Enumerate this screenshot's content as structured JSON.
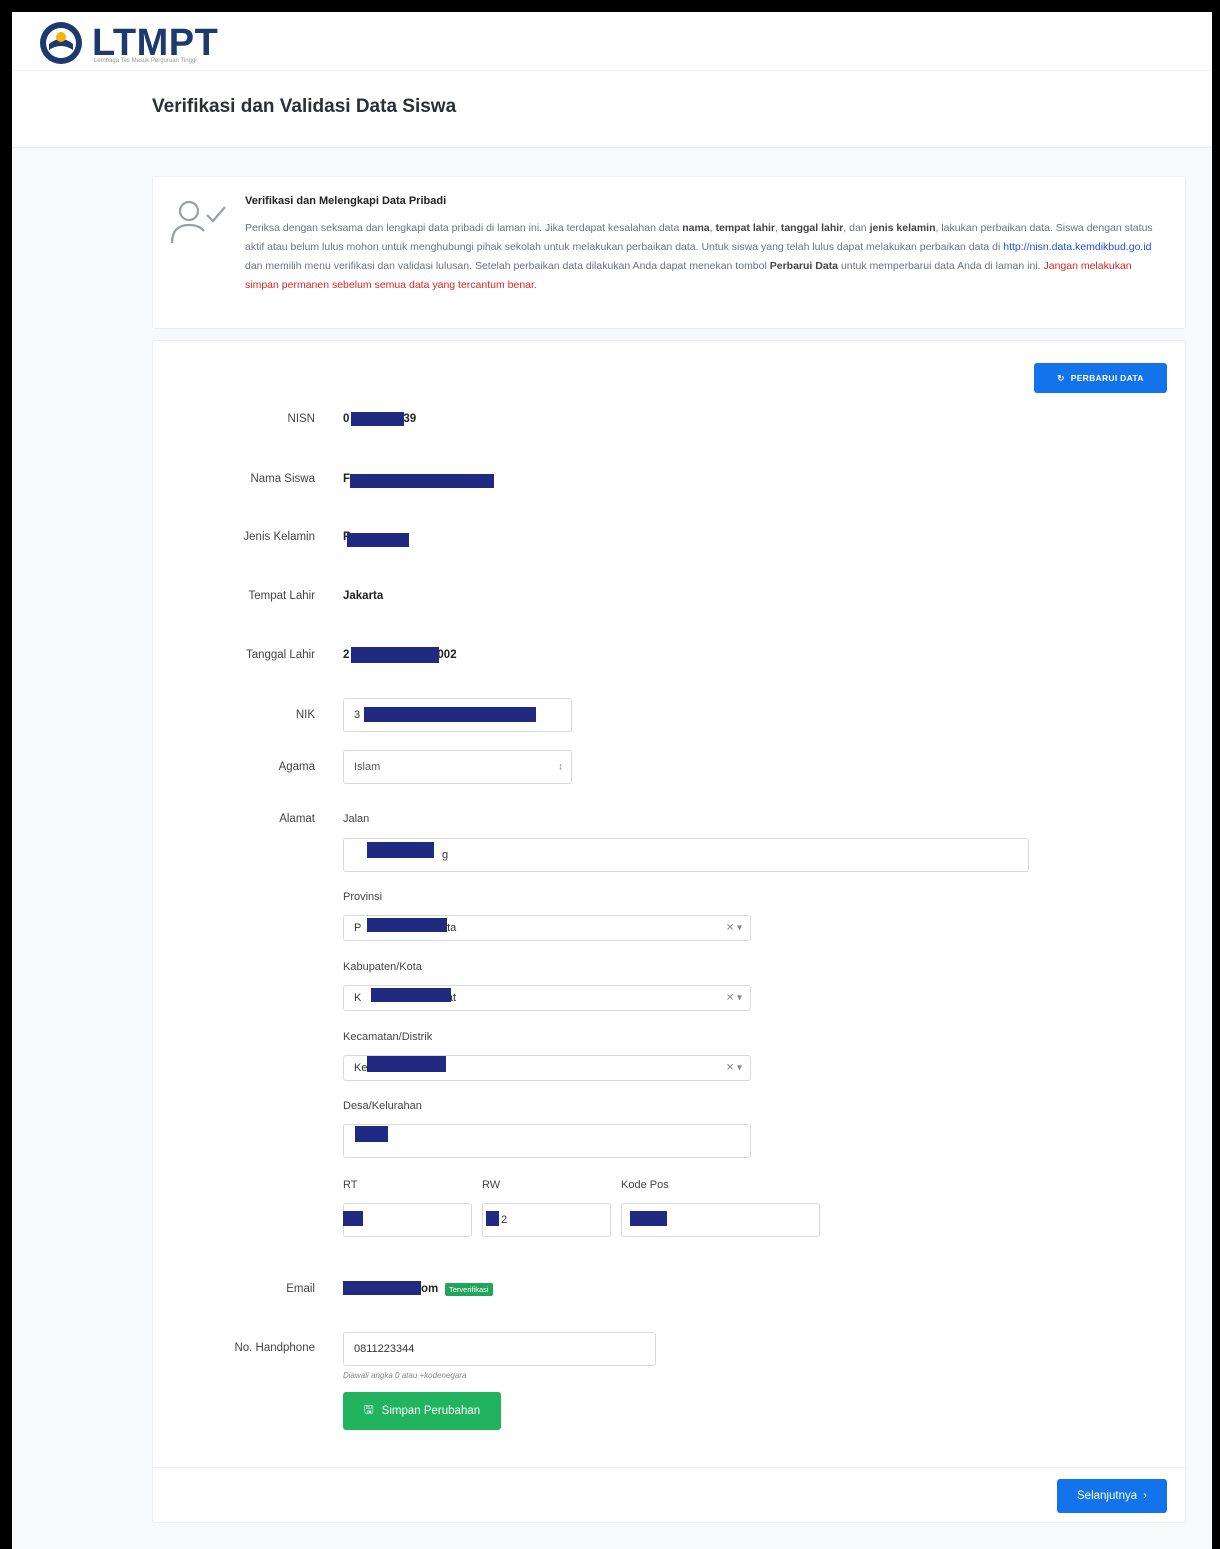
{
  "header": {
    "logo_text": "LTMPT",
    "logo_sub": "Lembaga Tes Masuk Perguruan Tinggi",
    "page_title": "Verifikasi dan Validasi Data Siswa"
  },
  "info": {
    "title": "Verifikasi dan Melengkapi Data Pribadi",
    "p1": "Periksa dengan seksama dan lengkapi data pribadi di laman ini. Jika terdapat kesalahan data ",
    "b1": "nama",
    "s1": ", ",
    "b2": "tempat lahir",
    "s2": ", ",
    "b3": "tanggal lahir",
    "s3": ", dan ",
    "b4": "jenis kelamin",
    "p2": ", lakukan perbaikan data. Siswa dengan status aktif atau belum lulus mohon untuk menghubungi pihak sekolah untuk melakukan perbaikan data. Untuk siswa yang telah lulus dapat melakukan perbaikan data di ",
    "link": "http://nisn.data.kemdikbud.go.id",
    "p3": " dan memilih menu verifikasi dan validasi lulusan. Setelah perbaikan data dilakukan Anda dapat menekan tombol ",
    "b5": "Perbarui Data",
    "p4": " untuk memperbarui data Anda di laman ini. ",
    "warning": "Jangan melakukan simpan permanen sebelum semua data yang tercantum benar."
  },
  "buttons": {
    "refresh": "PERBARUI DATA",
    "save": "Simpan Perubahan",
    "next": "Selanjutnya"
  },
  "labels": {
    "nisn": "NISN",
    "nama": "Nama Siswa",
    "jk": "Jenis Kelamin",
    "tempat": "Tempat Lahir",
    "tanggal": "Tanggal Lahir",
    "nik": "NIK",
    "agama": "Agama",
    "alamat": "Alamat",
    "jalan": "Jalan",
    "provinsi": "Provinsi",
    "kabupaten": "Kabupaten/Kota",
    "kecamatan": "Kecamatan/Distrik",
    "desa": "Desa/Kelurahan",
    "rt": "RT",
    "rw": "RW",
    "kodepos": "Kode Pos",
    "email": "Email",
    "hp": "No. Handphone"
  },
  "values": {
    "nisn_start": "0",
    "nisn_end": "39",
    "nama_start": "F",
    "jk_start": "P",
    "tempat": "Jakarta",
    "tanggal_start": "2",
    "tanggal_end": "002",
    "nik_start": "3",
    "agama": "Islam",
    "jalan_end": "g",
    "provinsi_start": "P",
    "provinsi_end": "arta",
    "kabupaten_start": "K",
    "kabupaten_end": "sat",
    "kecamatan_start": "Ke",
    "rw_end": "2",
    "email_end": "om",
    "email_badge": "Terverifikasi",
    "hp": "0811223344",
    "hp_hint": "Diawali angka 0 atau +kodenegara"
  },
  "colors": {
    "primary": "#1273eb",
    "success": "#22b35e",
    "warning": "#dc2626",
    "redaction": "#1f2a80",
    "logo": "#1e3a6d"
  }
}
